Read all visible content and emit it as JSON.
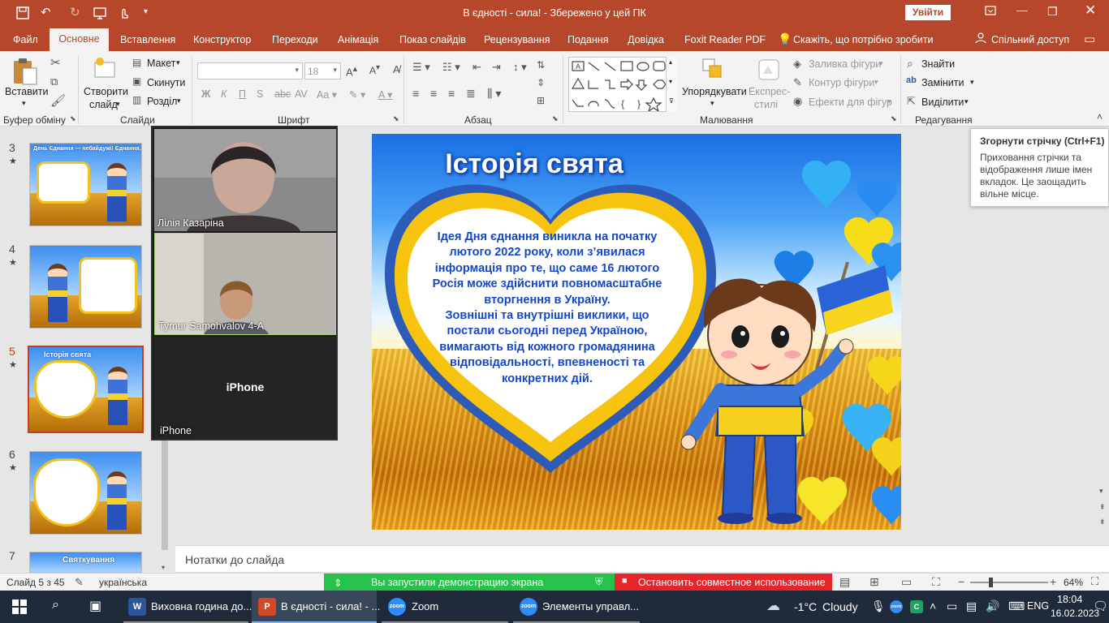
{
  "window": {
    "title": "В єдності - сила!  -  Збережено у цей ПК",
    "sign_in": "Увійти"
  },
  "tabs": [
    "Файл",
    "Основне",
    "Вставлення",
    "Конструктор",
    "Переходи",
    "Анімація",
    "Показ слайдів",
    "Рецензування",
    "Подання",
    "Довідка",
    "Foxit Reader PDF"
  ],
  "tell_me": "Скажіть, що потрібно зробити",
  "share": "Спільний доступ",
  "ribbon": {
    "clipboard": {
      "paste": "Вставити",
      "label": "Буфер обміну"
    },
    "slides": {
      "new_slide_1": "Створити",
      "new_slide_2": "слайд",
      "layout": "Макет",
      "reset": "Скинути",
      "section": "Розділ",
      "label": "Слайди"
    },
    "font": {
      "size": "18",
      "bold": "Ж",
      "italic": "К",
      "underline": "П",
      "strike": "S",
      "label": "Шрифт"
    },
    "paragraph": {
      "label": "Абзац"
    },
    "drawing": {
      "arrange": "Упорядкувати",
      "quick_styles_1": "Експрес-",
      "quick_styles_2": "стилі",
      "fill": "Заливка фігури",
      "outline": "Контур фігури",
      "effects": "Ефекти для фігур",
      "label": "Малювання"
    },
    "editing": {
      "find": "Знайти",
      "replace": "Замінити",
      "select": "Виділити",
      "label": "Редагування"
    }
  },
  "tooltip": {
    "title": "Згорнути стрічку (Ctrl+F1)",
    "body": "Приховання стрічки та відображення лише імен вкладок. Це заощадить вільне місце."
  },
  "thumbnails": [
    {
      "num": "3",
      "title": "День Єднання — небайдужі! Єднання."
    },
    {
      "num": "4",
      "title": ""
    },
    {
      "num": "5",
      "title": "Історія свята"
    },
    {
      "num": "6",
      "title": ""
    },
    {
      "num": "7",
      "title": "Святкування"
    }
  ],
  "zoom": {
    "participants": [
      {
        "name": "Лілія Казаріна"
      },
      {
        "name": "Tymur Samohvalov 4-А"
      },
      {
        "name": "iPhone",
        "center": "iPhone"
      }
    ]
  },
  "slide": {
    "title": "Історія свята",
    "body": [
      "Ідея Дня єднання виникла на початку лютого 2022 року, коли з’явилася інформація про те, що саме 16 лютого Росія може здійснити повномасштабне вторгнення в Україну.",
      "Зовнішні та внутрішні виклики, що постали сьогодні перед Україною, вимагають від кожного громадянина відповідальності, впевненості та конкретних дій."
    ]
  },
  "notes": {
    "placeholder": "Нотатки до слайда"
  },
  "status": {
    "slide": "Слайд 5 з 45",
    "language": "українська",
    "share_msg": "Вы запустили демонстрацию экрана",
    "stop_share": "Остановить совместное использование",
    "zoom": "64%"
  },
  "taskbar": {
    "items": [
      "Виховна година до...",
      "В єдності - сила! - ...",
      "Zoom",
      "Элементы управл..."
    ],
    "weather_temp": "-1°C",
    "weather_text": "Cloudy",
    "lang": "ENG",
    "time": "18:04",
    "date": "16.02.2023"
  },
  "colors": {
    "accent": "#b7472a",
    "zoom_green": "#27c24c",
    "zoom_red": "#e5252a",
    "slide_text": "#1447c7",
    "heart_yellow": "#f6c40f"
  }
}
